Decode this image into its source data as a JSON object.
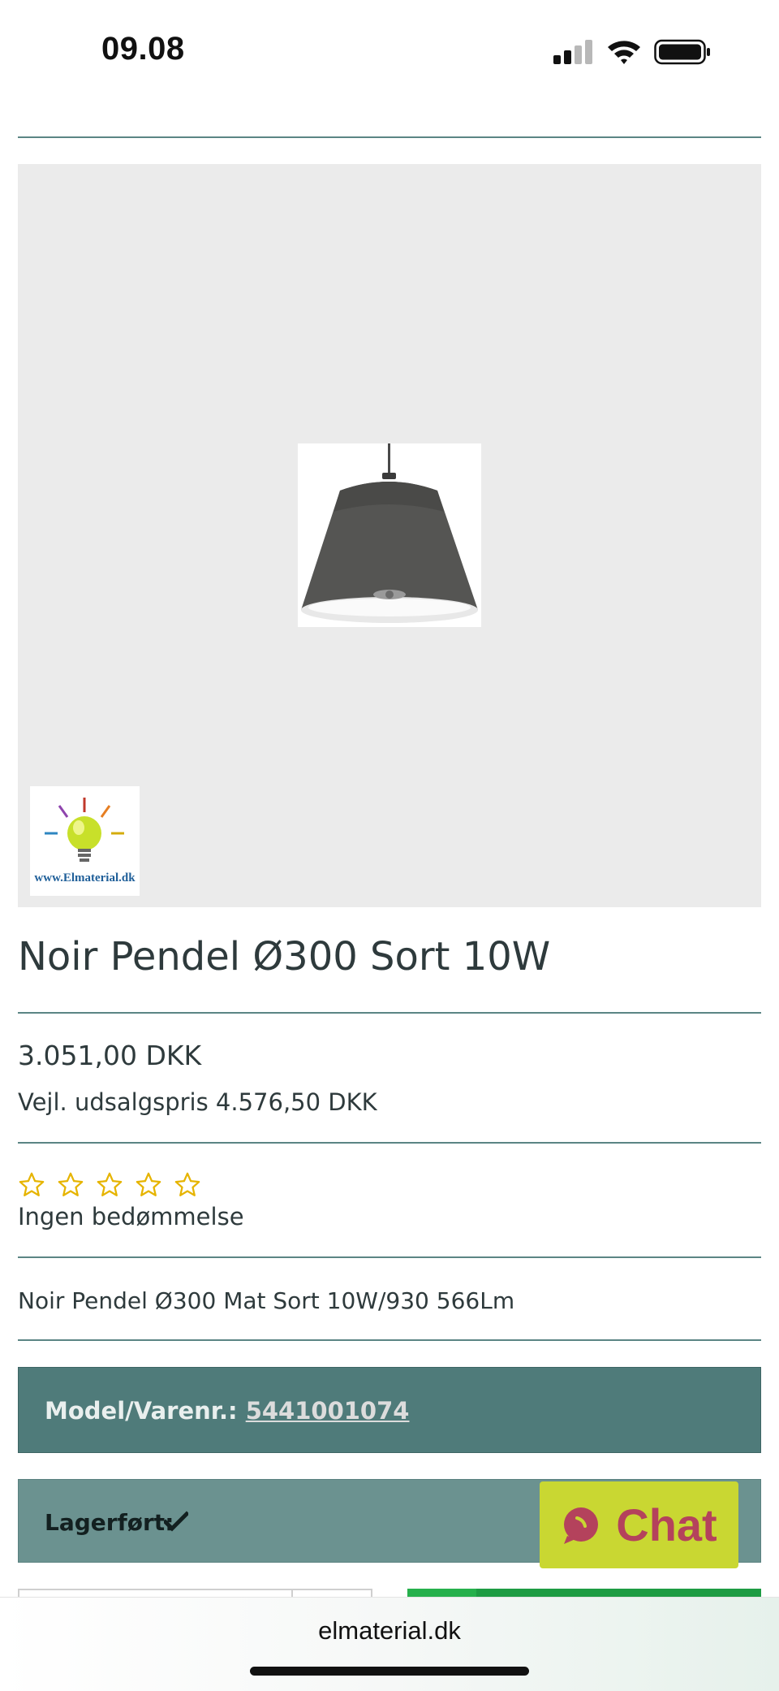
{
  "status_bar": {
    "time": "09.08",
    "icons": [
      "signal-icon",
      "wifi-icon",
      "battery-icon"
    ]
  },
  "product": {
    "image_icon": "pendant-lamp-image",
    "logo_text": "www.Elmaterial.dk",
    "title": "Noir Pendel Ø300 Sort 10W",
    "price": "3.051,00 DKK",
    "recommended_price": "Vejl. udsalgspris 4.576,50 DKK",
    "rating": {
      "stars_total": 5,
      "stars_filled": 0,
      "label": "Ingen bedømmelse"
    },
    "description": "Noir Pendel Ø300 Mat Sort 10W/930 566Lm",
    "model_label": "Model/Varenr.:",
    "model_number": "5441001074",
    "stock_label": "Lagerført:",
    "stock_icon": "check-icon"
  },
  "chat": {
    "label": "Chat",
    "icon": "chat-bubble-icon"
  },
  "browser": {
    "url": "elmaterial.dk"
  },
  "colors": {
    "teal_dark": "#4f7b7a",
    "teal_light": "#6b9290",
    "chat_bg": "#c9d732",
    "chat_fg": "#b4425c",
    "star": "#e6b400",
    "cta_green": "#1e9c43"
  }
}
